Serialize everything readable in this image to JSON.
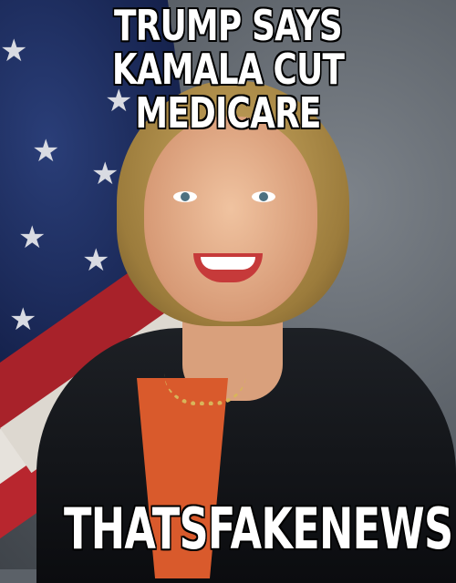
{
  "meme": {
    "top_text_line1": "TRUMP SAYS",
    "top_text_line2": "KAMALA CUT MEDICARE",
    "bottom_text": "THATSFAKENEWS"
  },
  "colors": {
    "text": "#ffffff",
    "outline": "#000000",
    "background": "#5b6168",
    "flag_blue": "#1c2a5c",
    "flag_red": "#b8262e"
  }
}
